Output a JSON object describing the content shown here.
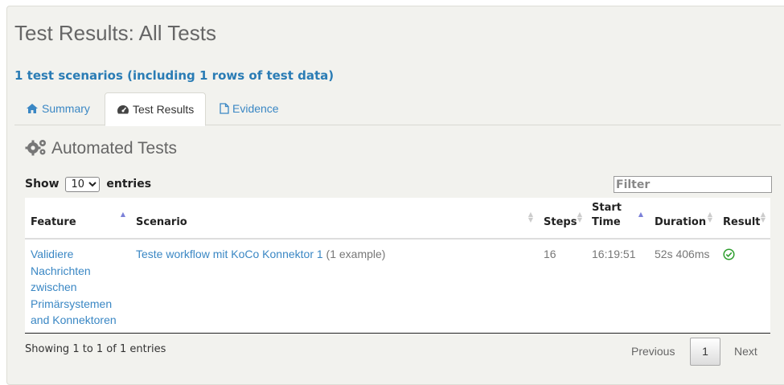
{
  "page": {
    "title": "Test Results: All Tests",
    "scenario_summary": "1 test scenarios (including 1 rows of test data)"
  },
  "tabs": [
    {
      "label": "Summary",
      "icon": "home-icon"
    },
    {
      "label": "Test Results",
      "icon": "dashboard-icon",
      "active": true
    },
    {
      "label": "Evidence",
      "icon": "file-icon"
    }
  ],
  "section": {
    "title": "Automated Tests",
    "icon": "cogs-icon"
  },
  "controls": {
    "show_label": "Show",
    "entries_label": "entries",
    "page_size": "10",
    "filter_placeholder": "Filter"
  },
  "table": {
    "columns": [
      "Feature",
      "Scenario",
      "Steps",
      "Start Time",
      "Duration",
      "Result"
    ],
    "rows": [
      {
        "feature": "Validiere Nachrichten zwischen Primärsystemen and Konnektoren",
        "scenario": "Teste workflow mit KoCo Konnektor 1",
        "scenario_note": "(1 example)",
        "steps": "16",
        "start_time": "16:19:51",
        "duration": "52s 406ms",
        "result": "success",
        "result_icon": "check-circle-icon"
      }
    ]
  },
  "footer": {
    "info": "Showing 1 to 1 of 1 entries",
    "previous": "Previous",
    "current_page": "1",
    "next": "Next"
  },
  "colors": {
    "accent": "#3a87c4",
    "success": "#2e9e2e",
    "panel": "#f2f2ee"
  }
}
